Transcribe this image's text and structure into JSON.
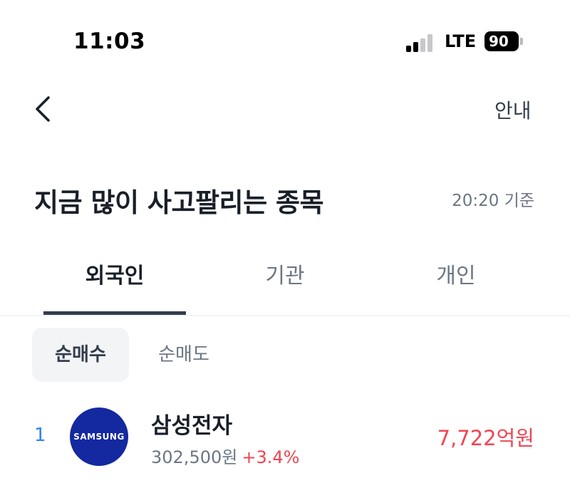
{
  "status_bar": {
    "time": "11:03",
    "network": "LTE",
    "battery": "90"
  },
  "header": {
    "help_label": "안내"
  },
  "title": {
    "text": "지금 많이 사고팔리는 종목",
    "basis": "20:20 기준"
  },
  "tabs": [
    {
      "label": "외국인",
      "active": true
    },
    {
      "label": "기관",
      "active": false
    },
    {
      "label": "개인",
      "active": false
    }
  ],
  "filters": [
    {
      "label": "순매수",
      "active": true
    },
    {
      "label": "순매도",
      "active": false
    }
  ],
  "stocks": [
    {
      "rank": "1",
      "name": "삼성전자",
      "logo_text": "SAMSUNG",
      "price": "302,500원",
      "change": "+3.4%",
      "amount": "7,722억원"
    }
  ],
  "colors": {
    "accent": "#3182f6",
    "rise": "#f04452",
    "brand_samsung": "#1428a0"
  }
}
